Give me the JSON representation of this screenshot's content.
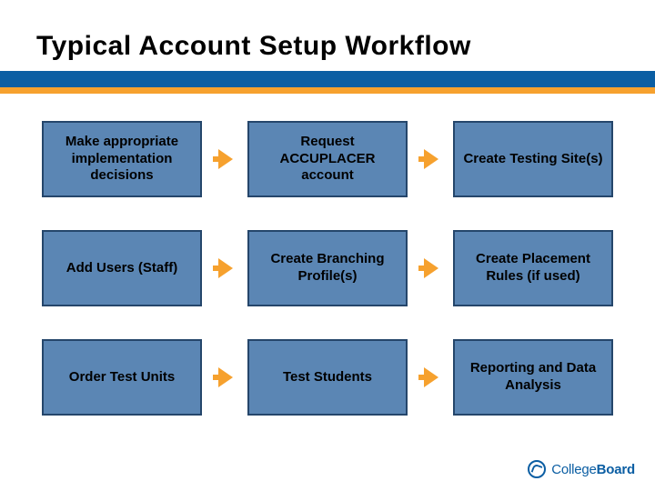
{
  "title": "Typical Account Setup Workflow",
  "steps": [
    "Make appropriate implementation decisions",
    "Request ACCUPLACER account",
    "Create Testing Site(s)",
    "Add Users (Staff)",
    "Create Branching Profile(s)",
    "Create Placement Rules (if used)",
    "Order Test Units",
    "Test Students",
    "Reporting and Data Analysis"
  ],
  "footer": {
    "brand_prefix": "College",
    "brand_bold": "Board"
  },
  "colors": {
    "blue": "#0b5ea3",
    "orange": "#f6a12e",
    "box_fill": "#5b86b4",
    "box_border": "#25466b"
  }
}
